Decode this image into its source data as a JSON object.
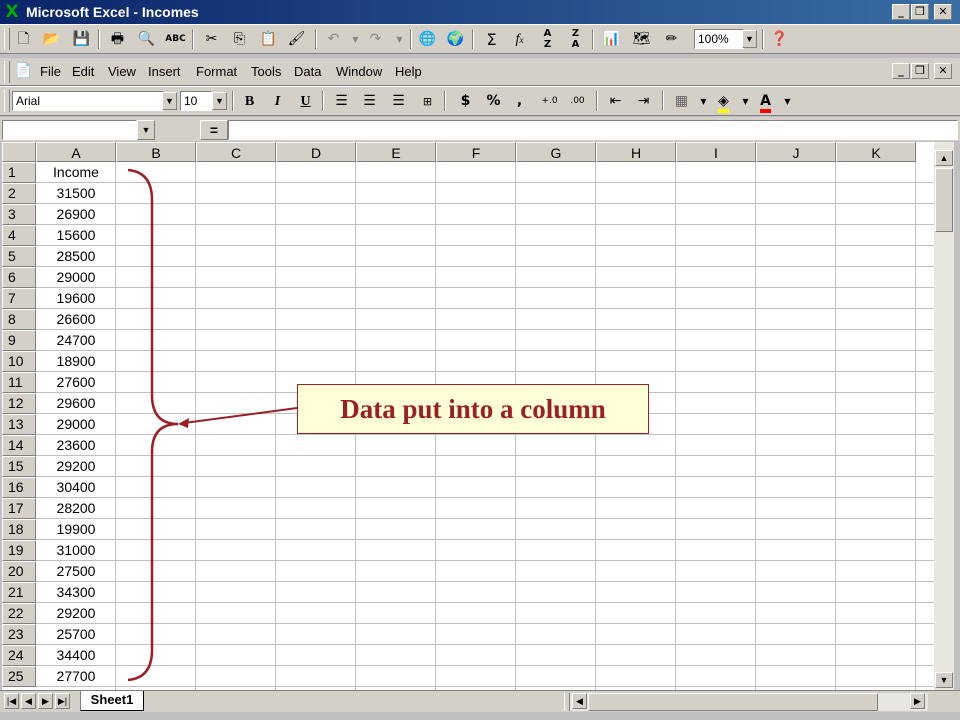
{
  "window": {
    "title": "Microsoft Excel - Incomes",
    "logo": "X",
    "min_label": "_",
    "restore_label": "❐",
    "close_label": "✕"
  },
  "menu": [
    "File",
    "Edit",
    "View",
    "Insert",
    "Format",
    "Tools",
    "Data",
    "Window",
    "Help"
  ],
  "standard_toolbar": {
    "zoom": "100%",
    "icons": [
      "new-icon",
      "open-icon",
      "save-icon",
      "print-icon",
      "print-preview-icon",
      "spelling-icon",
      "cut-icon",
      "copy-icon",
      "paste-icon",
      "format-painter-icon",
      "undo-icon",
      "redo-icon",
      "insert-hyperlink-icon",
      "web-toolbar-icon",
      "autosum-icon",
      "paste-function-icon",
      "sort-ascending-icon",
      "sort-descending-icon",
      "chart-wizard-icon",
      "map-icon",
      "drawing-icon",
      "help-icon"
    ]
  },
  "format_toolbar": {
    "font": "Arial",
    "size": "10",
    "bold": "B",
    "italic": "I",
    "underline": "U",
    "currency": "$",
    "percent": "%",
    "comma": ","
  },
  "formula_bar": {
    "name_box": "",
    "equals": "=",
    "formula": ""
  },
  "grid": {
    "columns": [
      "A",
      "B",
      "C",
      "D",
      "E",
      "F",
      "G",
      "H",
      "I",
      "J",
      "K"
    ],
    "rows": [
      "1",
      "2",
      "3",
      "4",
      "5",
      "6",
      "7",
      "8",
      "9",
      "10",
      "11",
      "12",
      "13",
      "14",
      "15",
      "16",
      "17",
      "18",
      "19",
      "20",
      "21",
      "22",
      "23",
      "24",
      "25"
    ],
    "column_a": [
      "Income",
      "31500",
      "26900",
      "15600",
      "28500",
      "29000",
      "19600",
      "26600",
      "24700",
      "18900",
      "27600",
      "29600",
      "29000",
      "23600",
      "29200",
      "30400",
      "28200",
      "19900",
      "31000",
      "27500",
      "34300",
      "29200",
      "25700",
      "34400",
      "27700"
    ]
  },
  "sheet_tabs": [
    "Sheet1"
  ],
  "annotation": {
    "text": "Data put into a column",
    "color": "#9b1f24",
    "background": "#ffffd8"
  }
}
